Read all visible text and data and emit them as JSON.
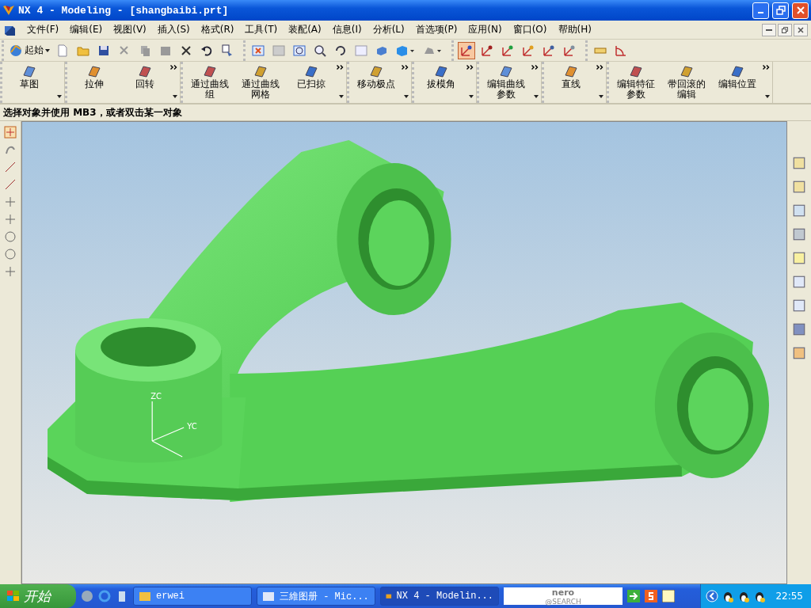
{
  "window": {
    "title": "NX 4 - Modeling - [shangbaibi.prt]"
  },
  "menu": [
    "文件(F)",
    "编辑(E)",
    "视图(V)",
    "插入(S)",
    "格式(R)",
    "工具(T)",
    "装配(A)",
    "信息(I)",
    "分析(L)",
    "首选项(P)",
    "应用(N)",
    "窗口(O)",
    "帮助(H)"
  ],
  "standard_toolbar": {
    "start_label": "起始"
  },
  "selection_toolbar": [
    {
      "selected": true
    },
    {
      "selected": false
    },
    {
      "selected": false
    },
    {
      "selected": false
    },
    {
      "selected": false
    },
    {
      "selected": false
    }
  ],
  "feature_toolbars": [
    {
      "items": [
        "草图"
      ],
      "more": false
    },
    {
      "items": [
        "拉伸",
        "回转"
      ],
      "more": true
    },
    {
      "items": [
        "通过曲线组",
        "通过曲线网格",
        "已扫掠"
      ],
      "more": true
    },
    {
      "items": [
        "移动极点"
      ],
      "more": true
    },
    {
      "items": [
        "拔模角"
      ],
      "more": true
    },
    {
      "items": [
        "编辑曲线参数"
      ],
      "more": true
    },
    {
      "items": [
        "直线"
      ],
      "more": true
    },
    {
      "items": [
        "编辑特征参数",
        "带回滚的编辑",
        "编辑位置"
      ],
      "more": true
    }
  ],
  "status_prompt": "选择对象并使用 MB3，或者双击某一对象",
  "viewport": {
    "triad_labels": [
      "ZC",
      "YC"
    ]
  },
  "taskbar": {
    "start": "开始",
    "tasks": [
      {
        "label": "erwei",
        "selected": false
      },
      {
        "label": "三維图册 - Mic...",
        "selected": false
      },
      {
        "label": "NX 4 - Modelin...",
        "selected": true
      }
    ],
    "search_logo": [
      "nero",
      "@SEARCH"
    ],
    "clock": "22:55"
  }
}
